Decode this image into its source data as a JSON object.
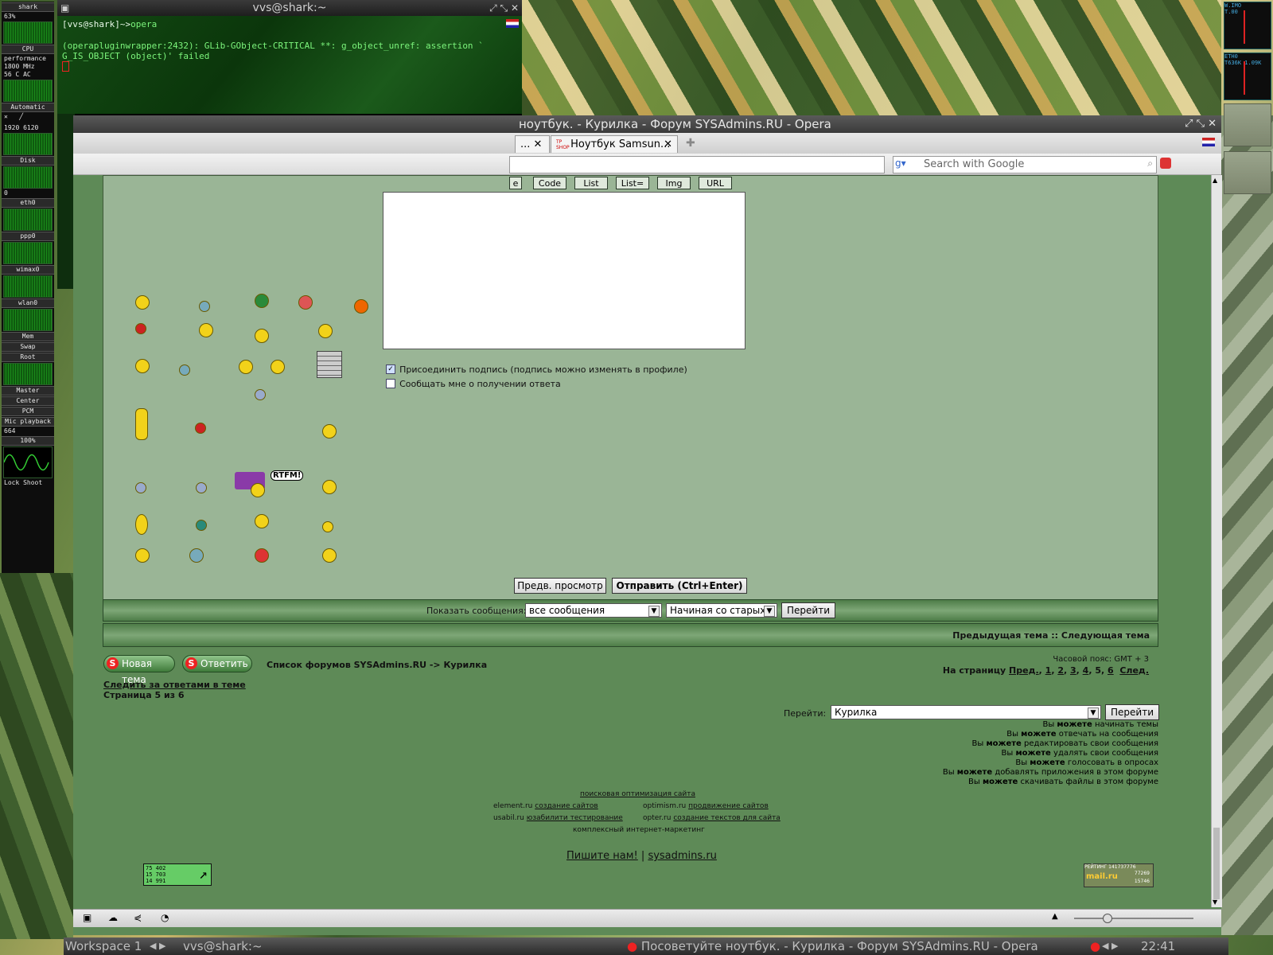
{
  "conky": {
    "host": "shark",
    "cpu_percent": "63%",
    "cpu_label": "CPU",
    "governor": "performance",
    "freq": "1800 MHz",
    "temp": "56 C",
    "ac": "AC",
    "fan_mode": "Automatic",
    "fan1": "1920",
    "fan2": "6120",
    "disk": "Disk",
    "zero": "0",
    "eth0": "eth0",
    "ppp0": "ppp0",
    "wimax0": "wimax0",
    "wlan0": "wlan0",
    "mem": "Mem",
    "swap": "Swap",
    "root": "Root",
    "master": "Master",
    "center": "Center",
    "pcm": "PCM",
    "mic": "Mic playback",
    "val664": "664",
    "batt": "100%",
    "lock": "Lock",
    "shoot": "Shoot"
  },
  "rpanel": {
    "wimo": "W.IMO",
    "eth0": "ETH0",
    "rate": "T.00",
    "rate2": "T636K 1.09K"
  },
  "terminal": {
    "title": "vvs@shark:~",
    "prompt": "[vvs@shark]~>",
    "command": "opera",
    "output_line1": "(operapluginwrapper:2432): GLib-GObject-CRITICAL **: g_object_unref: assertion `",
    "output_line2": "G_IS_OBJECT (object)' failed"
  },
  "opera": {
    "title": "ноутбук. - Курилка - Форум SYSAdmins.RU - Opera",
    "tabs": [
      {
        "label": "..."
      },
      {
        "label": "Ноутбук Samsun..."
      }
    ],
    "tab_favicon": "TP SHOP",
    "search_placeholder": "Search with Google"
  },
  "editor": {
    "bbcode_buttons": [
      "e",
      "Code",
      "List",
      "List=",
      "Img",
      "URL"
    ],
    "attach_signature": "Присоединить подпись (подпись можно изменять в профиле)",
    "notify_reply": "Сообщать мне о получении ответа",
    "rtfm": "RTFM!",
    "preview_button": "Предв. просмотр",
    "submit_button": "Отправить (Ctrl+Enter)"
  },
  "display": {
    "label": "Показать сообщения:",
    "filter_value": "все сообщения",
    "order_value": "Начиная со старых",
    "go_button": "Перейти"
  },
  "topic_nav": {
    "prev": "Предыдущая тема",
    "sep": "::",
    "next": "Следующая тема"
  },
  "footer": {
    "new_topic": "Новая тема",
    "reply": "Ответить",
    "breadcrumb": "Список форумов SYSAdmins.RU -> Курилка",
    "timezone": "Часовой пояс: GMT + 3",
    "page_label": "На страницу",
    "prev_link": "Пред.",
    "pages": [
      "1",
      "2",
      "3",
      "4",
      "5",
      "6"
    ],
    "next_link": "След.",
    "watch_topic": "Следить за ответами в теме",
    "page_of": "Страница 5 из 6",
    "jump_label": "Перейти:",
    "jump_value": "Курилка",
    "jump_button": "Перейти",
    "perms": [
      [
        "Вы ",
        "можете",
        " начинать темы"
      ],
      [
        "Вы ",
        "можете",
        " отвечать на сообщения"
      ],
      [
        "Вы ",
        "можете",
        " редактировать свои сообщения"
      ],
      [
        "Вы ",
        "можете",
        " удалять свои сообщения"
      ],
      [
        "Вы ",
        "можете",
        " голосовать в опросах"
      ],
      [
        "Вы ",
        "можете",
        " добавлять приложения в этом форуме"
      ],
      [
        "Вы ",
        "можете",
        " скачивать файлы в этом форуме"
      ]
    ],
    "seo_title": "поисковая оптимизация сайта",
    "seo1_site": "element.ru",
    "seo1_link": "создание сайтов",
    "seo2_site": "optimism.ru",
    "seo2_link": "продвижение сайтов",
    "seo3_site": "usabil.ru",
    "seo3_link": "юзабилити тестирование",
    "seo4_site": "opter.ru",
    "seo4_link": "создание текстов для сайта",
    "seo_bottom": "комплексный интернет-маркетинг",
    "write_us": "Пишите нам!",
    "pipe": "|",
    "site_link": "sysadmins.ru",
    "counter1": [
      "75 402",
      "15 703",
      "14 991"
    ],
    "rating_label": "РЕЙТИНГ",
    "rating_num": "141737776",
    "rating_v1": "77269",
    "rating_v2": "15746",
    "mailru": "mail.ru"
  },
  "taskbar": {
    "workspace": "Workspace 1",
    "task1": "vvs@shark:~",
    "task2": "Посоветуйте ноутбук. - Курилка - Форум SYSAdmins.RU - Opera",
    "clock": "22:41"
  }
}
